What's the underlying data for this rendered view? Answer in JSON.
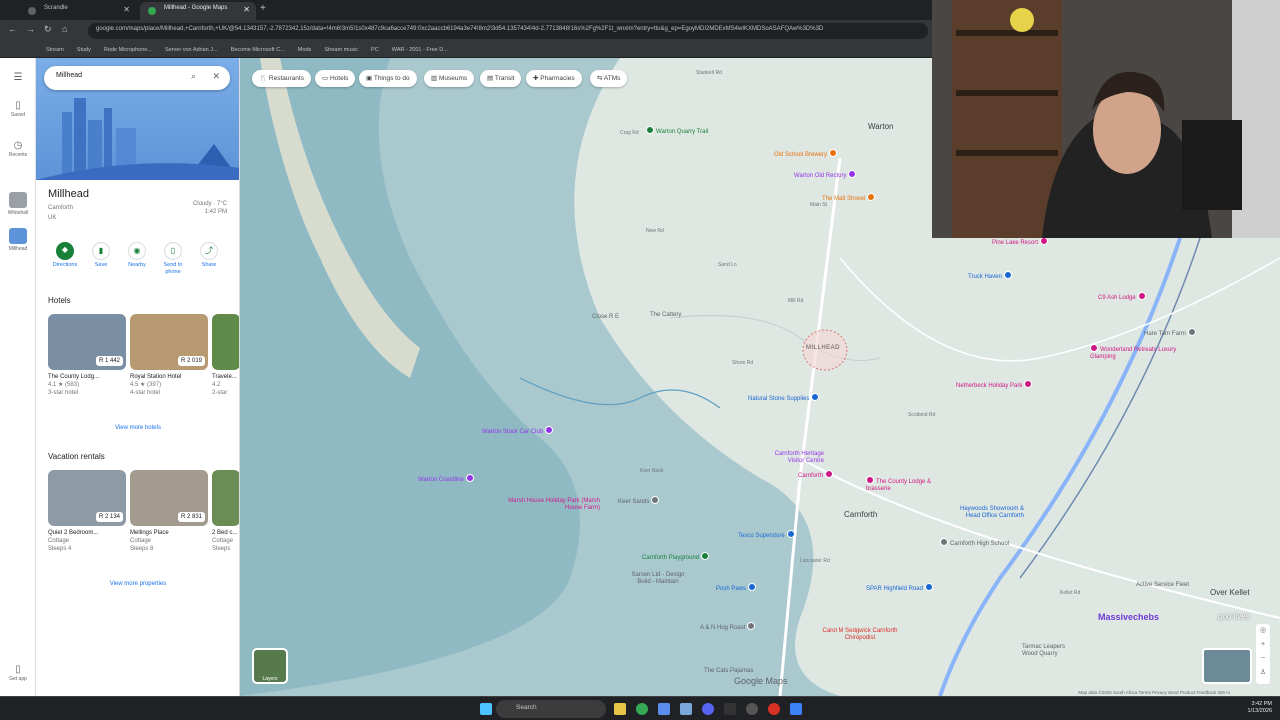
{
  "browser": {
    "tabs": [
      {
        "label": "Scrandle",
        "close": "✕"
      },
      {
        "label": "Millhead - Google Maps",
        "close": "✕"
      }
    ],
    "new_tab": "+",
    "url": "google.com/maps/place/Millhead,+Carnforth,+UK/@54.1343157,-2.7872342,15z/data=!4m6!3m5!1s0x487c9ca6acce749:0xc2aaccb6194a3e74!8m2!3d54.1357434!4d-2.7713848!16s%2Fg%2F1t_wnxlm?entry=ttu&g_ep=EgoyMDI2MDExMS4wIKXMDSoASAFQAw%3D%3D",
    "bookmarks": [
      "Stream",
      "Study",
      "Rode Microphone...",
      "Server von Adrian J...",
      "Become Microsoft C...",
      "Mods",
      "Stream music",
      "PC",
      "WAR - 2001 - Free D..."
    ]
  },
  "rail": {
    "saved": "Saved",
    "recents": "Recents",
    "whitehall": "Whitehall",
    "millhead": "Millhead",
    "get_app": "Get app"
  },
  "panel": {
    "search_value": "Millhead",
    "place_title": "Millhead",
    "subtitle1": "Carnforth",
    "subtitle2": "UK",
    "weather_line1": "Cloudy · 7°C",
    "weather_line2": "1:42 PM",
    "actions": [
      "Directions",
      "Save",
      "Nearby",
      "Send to phone",
      "Share"
    ],
    "hotels_heading": "Hotels",
    "hotels": [
      {
        "name": "The County Lodg...",
        "price": "R 1 442",
        "rating": "4.1 ★ (583)",
        "cls": "3-star hotel"
      },
      {
        "name": "Royal Station Hotel",
        "price": "R 2 019",
        "rating": "4.5 ★ (397)",
        "cls": "4-star hotel"
      },
      {
        "name": "Travele...",
        "price": "",
        "rating": "4.2",
        "cls": "2-star"
      }
    ],
    "view_hotels": "View more hotels",
    "rentals_heading": "Vacation rentals",
    "rentals": [
      {
        "name": "Quiet 2 Bedroom...",
        "price": "R 2 134",
        "type": "Cottage",
        "sleeps": "Sleeps 4"
      },
      {
        "name": "Mellings Place",
        "price": "R 2 831",
        "type": "Cottage",
        "sleeps": "Sleeps 8"
      },
      {
        "name": "2 Bed c...",
        "price": "",
        "type": "Cottage",
        "sleeps": "Sleeps"
      }
    ],
    "view_properties": "View more properties"
  },
  "map": {
    "chips": [
      "Restaurants",
      "Hotels",
      "Things to do",
      "Museums",
      "Transit",
      "Pharmacies",
      "ATMs"
    ],
    "towns": [
      "Warton",
      "Carnforth",
      "Over Kellet",
      "MILLHEAD"
    ],
    "places": [
      "Warton Quarry Trail",
      "Old School Brewery",
      "Warton Old Rectory",
      "The Malt Shovel",
      "Pine Lake Resort",
      "Truck Haven",
      "C9 Ash Lodge",
      "Hare Tarn Farm",
      "Wonderland Retreats Luxury Glamping",
      "Netherbeck Holiday Park",
      "Natural Stone Supplies",
      "Carnforth Heritage Visitor Centre",
      "Carnforth",
      "The County Lodge & brasserie",
      "Haywoods Showroom & Head Office Carnforth",
      "Carnforth High School",
      "Tesco Superstore",
      "Warton Stock Car Club",
      "Warton Coastline",
      "Marsh House Holiday Park (Marsh House Farm)",
      "Keer Sands",
      "Carnforth Playground",
      "Sarsen Ltd - Design Build - Maintain",
      "Posh Paws",
      "SPAR Highfield Road",
      "Carol M Sedgwick Carnforth Chiropodist",
      "A & N Hog Roast",
      "The Cats Pajamas",
      "Tarmac Leapers Wood Quarry",
      "Active Service Fleet",
      "Close R E",
      "The Cattery"
    ],
    "roads": [
      "Mill Rd",
      "New Rd",
      "Sand Ln",
      "Shore Rd",
      "Main St",
      "Crag Rd",
      "Lancaster Rd",
      "Kellet Rd",
      "Scotland Rd",
      "Stankelt Rd",
      "Keer Bank"
    ],
    "google_maps": "Google Maps",
    "attribution": "Map data ©2026   South Africa   Terms   Privacy   Send Product Feedback   200 m",
    "layers": "Layers",
    "zoom_in": "+",
    "zoom_out": "−"
  },
  "overlay": {
    "streamer_name": "Massivechebs",
    "poo_text": "poo lives"
  },
  "taskbar": {
    "search": "Search",
    "time": "3:42 PM",
    "date": "1/13/2026"
  }
}
